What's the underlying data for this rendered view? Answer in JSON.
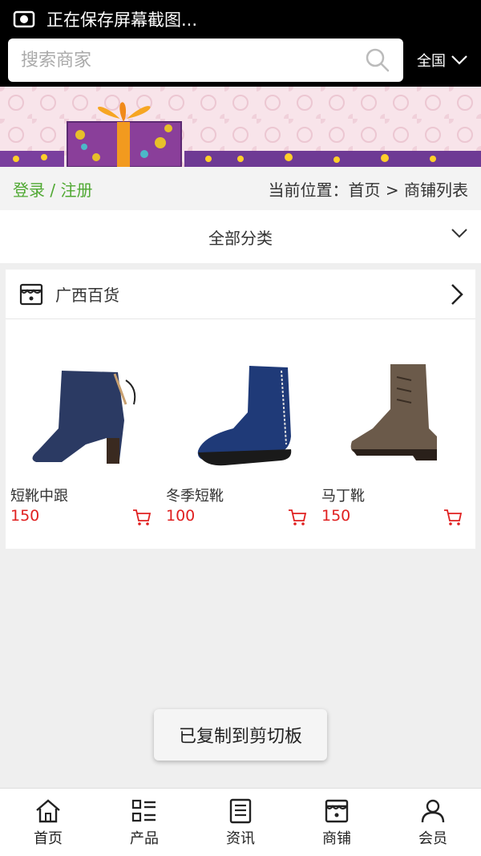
{
  "status_bar": {
    "text": "正在保存屏幕截图..."
  },
  "header": {
    "search_placeholder": "搜索商家",
    "region": "全国"
  },
  "breadcrumb": {
    "login": "登录 / 注册",
    "location": "当前位置：首页 > 商铺列表"
  },
  "category": {
    "label": "全部分类"
  },
  "store": {
    "name": "广西百货",
    "products": [
      {
        "name": "短靴中跟",
        "price": "150"
      },
      {
        "name": "冬季短靴",
        "price": "100"
      },
      {
        "name": "马丁靴",
        "price": "150"
      }
    ]
  },
  "toast": {
    "text": "已复制到剪切板"
  },
  "tabbar": {
    "items": [
      {
        "label": "首页",
        "icon": "home-icon"
      },
      {
        "label": "产品",
        "icon": "list-icon"
      },
      {
        "label": "资讯",
        "icon": "news-icon"
      },
      {
        "label": "商铺",
        "icon": "shop-icon"
      },
      {
        "label": "会员",
        "icon": "user-icon"
      }
    ]
  },
  "colors": {
    "accent_green": "#4fa832",
    "price_red": "#e02020",
    "header_bg": "#000000"
  }
}
